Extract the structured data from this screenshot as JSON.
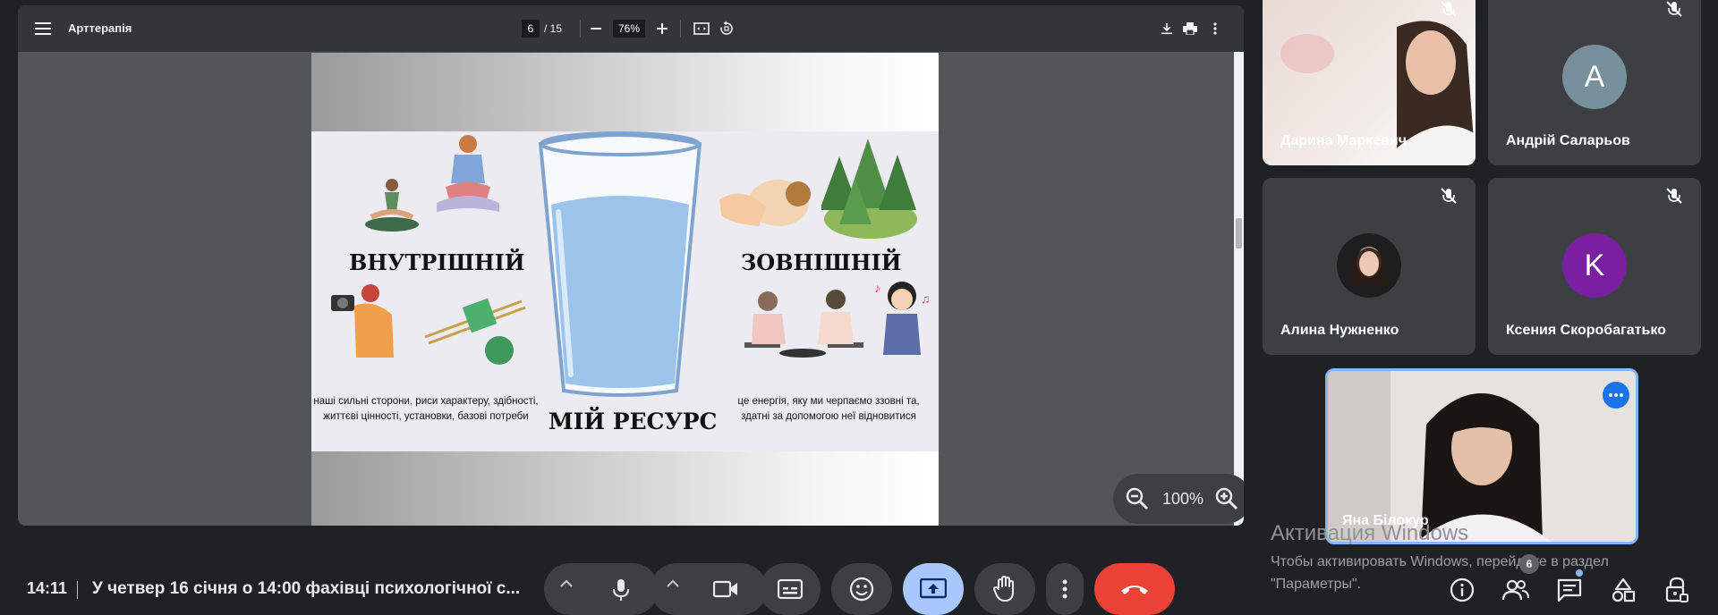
{
  "pdf": {
    "title": "Арттерапія",
    "page_current": "6",
    "page_total": "/ 15",
    "zoom": "76%"
  },
  "slide": {
    "left_heading": "ВНУТРІШНІЙ",
    "right_heading": "ЗОВНІШНІЙ",
    "center_heading": "МІЙ РЕСУРС",
    "left_text_line1": "наші сильні сторони, риси характеру, здібності,",
    "left_text_line2": "життєві цінності, установки, базові потреби",
    "right_text_line1": "це енергія, яку ми черпаємо ззовні та,",
    "right_text_line2": "здатні за допомогою неї відновитися"
  },
  "zoom_pill": {
    "level": "100%"
  },
  "participants": [
    {
      "name": "Дарина Маркевич"
    },
    {
      "name": "Андрій Саларьов",
      "initial": "A",
      "color": "#78909c"
    },
    {
      "name": "Алина Нужненко"
    },
    {
      "name": "Ксения Скоробагатько",
      "initial": "K",
      "color": "#7b1fa2"
    },
    {
      "name": "Яна Білокур"
    }
  ],
  "windows_watermark": {
    "title": "Активация Windows",
    "line1": "Чтобы активировать Windows, перейдите в раздел",
    "line2": "\"Параметры\"."
  },
  "bottom_bar": {
    "time": "14:11",
    "meeting_title": "У четвер 16 січня о 14:00 фахівці психологічної с...",
    "people_count": "6"
  },
  "colors": {
    "accent_blue": "#8ab4f8",
    "end_call": "#ea4335",
    "present_active": "#a8c7fa"
  }
}
